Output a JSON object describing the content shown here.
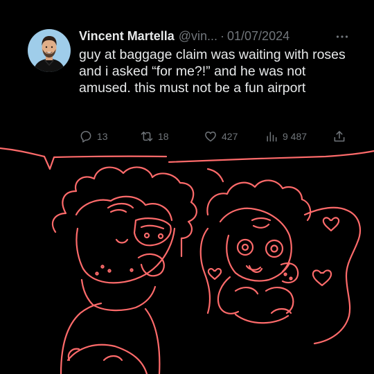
{
  "tweet": {
    "author_name": "Vincent Martella",
    "author_handle": "@vin...",
    "separator": "·",
    "date": "01/07/2024",
    "text": "guy at baggage claim was waiting with roses and i asked “for me?!” and he was not amused. this must not be a fun airport",
    "more_icon": "more-horizontal-icon",
    "actions": {
      "reply": {
        "count": "13",
        "icon": "reply-icon"
      },
      "retweet": {
        "count": "18",
        "icon": "retweet-icon"
      },
      "like": {
        "count": "427",
        "icon": "heart-icon"
      },
      "views": {
        "count": "9 487",
        "icon": "views-icon"
      },
      "share": {
        "icon": "share-icon"
      }
    }
  },
  "colors": {
    "background": "#000000",
    "text_primary": "#e7e9ea",
    "text_secondary": "#71767b",
    "drawing_stroke": "#ff6b6b",
    "avatar_bg": "#9fcdea"
  }
}
